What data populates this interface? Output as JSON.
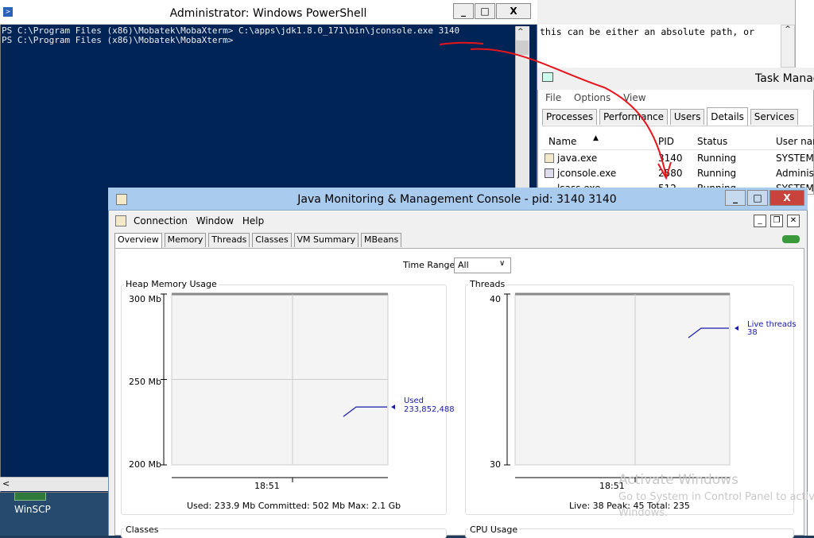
{
  "desktop": {
    "winscp_label": "WinSCP"
  },
  "editor": {
    "text": "this can be either an absolute path, or",
    "scroll_up": "^"
  },
  "task_manager": {
    "title": "Task Manag",
    "menu": [
      "File",
      "Options",
      "View"
    ],
    "tabs": [
      {
        "label": "Processes",
        "active": false
      },
      {
        "label": "Performance",
        "active": false
      },
      {
        "label": "Users",
        "active": false
      },
      {
        "label": "Details",
        "active": true
      },
      {
        "label": "Services",
        "active": false
      }
    ],
    "columns": [
      "Name",
      "PID",
      "Status",
      "User nam"
    ],
    "rows": [
      {
        "name": "java.exe",
        "pid": "3140",
        "status": "Running",
        "user": "SYSTEM"
      },
      {
        "name": "jconsole.exe",
        "pid": "2580",
        "status": "Running",
        "user": "Administ"
      },
      {
        "name": "lsass.exe",
        "pid": "512",
        "status": "Running",
        "user": "SYSTEM"
      }
    ]
  },
  "powershell": {
    "title": "Administrator: Windows PowerShell",
    "lines": [
      "PS C:\\Program Files (x86)\\Mobatek\\MobaXterm> C:\\apps\\jdk1.8.0_171\\bin\\jconsole.exe 3140",
      "PS C:\\Program Files (x86)\\Mobatek\\MobaXterm>"
    ],
    "buttons": {
      "minimize": "_",
      "maximize": "□",
      "close": "X"
    }
  },
  "jconsole": {
    "title": "Java Monitoring & Management Console - pid: 3140 3140",
    "menu": [
      "Connection",
      "Window",
      "Help"
    ],
    "tabs": [
      {
        "label": "Overview",
        "active": true
      },
      {
        "label": "Memory",
        "active": false
      },
      {
        "label": "Threads",
        "active": false
      },
      {
        "label": "Classes",
        "active": false
      },
      {
        "label": "VM Summary",
        "active": false
      },
      {
        "label": "MBeans",
        "active": false
      }
    ],
    "time_range_label": "Time Range:",
    "time_range_value": "All",
    "heap": {
      "title": "Heap Memory Usage",
      "y_ticks": [
        "300 Mb",
        "250 Mb",
        "200 Mb"
      ],
      "x_tick": "18:51",
      "series_label": "Used",
      "series_value": "233,852,488",
      "footer": "Used: 233.9 Mb    Committed: 502 Mb    Max: 2.1 Gb"
    },
    "threads": {
      "title": "Threads",
      "y_ticks": [
        "40",
        "30"
      ],
      "x_tick": "18:51",
      "series_label": "Live threads",
      "series_value": "38",
      "footer": "Live: 38    Peak: 45    Total: 235"
    },
    "classes_title": "Classes",
    "cpu_title": "CPU Usage"
  },
  "chart_data": [
    {
      "type": "line",
      "title": "Heap Memory Usage",
      "xlabel": "",
      "ylabel": "",
      "ylim": [
        200,
        300
      ],
      "y_unit": "Mb",
      "x": [
        "18:51"
      ],
      "series": [
        {
          "name": "Used",
          "values": [
            233.9
          ]
        }
      ],
      "grid": true
    },
    {
      "type": "line",
      "title": "Threads",
      "xlabel": "",
      "ylabel": "",
      "ylim": [
        30,
        40
      ],
      "x": [
        "18:51"
      ],
      "series": [
        {
          "name": "Live threads",
          "values": [
            38
          ]
        }
      ],
      "grid": true
    }
  ],
  "watermark": {
    "line1": "Activate Windows",
    "line2": "Go to System in Control Panel to activ",
    "line3": "Windows."
  },
  "colors": {
    "ps_bg": "#012456",
    "jc_title": "#a9cbee",
    "annotation": "#e8141c",
    "series": "#1a1aa8"
  }
}
